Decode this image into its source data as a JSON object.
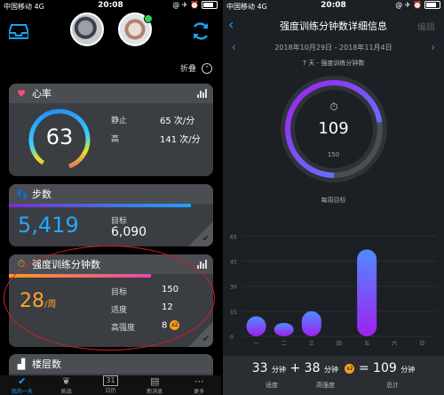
{
  "status_left": {
    "carrier": "中国移动",
    "network": "4G",
    "time": "20:08"
  },
  "status_right": {
    "carrier": "中国移动",
    "network": "4G",
    "time": "20:08"
  },
  "left": {
    "collapse_label": "折叠",
    "heart": {
      "title": "心率",
      "value": "63",
      "rest_label": "静止",
      "rest_value": "65 次/分",
      "high_label": "高",
      "high_value": "141 次/分"
    },
    "steps": {
      "title": "步数",
      "value": "5,419",
      "goal_label": "目标",
      "goal_value": "6,090"
    },
    "intensity": {
      "title": "强度训练分钟数",
      "value": "28",
      "unit": "/周",
      "goal_label": "目标",
      "goal_value": "150",
      "moderate_label": "适度",
      "moderate_value": "12",
      "vigorous_label": "高强度",
      "vigorous_value": "8",
      "badge": "x2"
    },
    "floors": {
      "title": "楼层数"
    },
    "tabs": [
      {
        "label": "我的一天",
        "icon": "check-icon"
      },
      {
        "label": "挑战",
        "icon": "laurel-icon"
      },
      {
        "label": "日历",
        "icon": "calendar-icon",
        "day": "31"
      },
      {
        "label": "新消息",
        "icon": "news-icon"
      },
      {
        "label": "更多",
        "icon": "more-icon"
      }
    ]
  },
  "right": {
    "title": "强度训练分钟数详细信息",
    "edit_label": "编辑",
    "date_range": "2018年10月29日 - 2018年11月4日",
    "subtitle": "7 天 - 强度训练分钟数",
    "gauge_value": "109",
    "gauge_goal": "150",
    "goal_caption": "每周目标",
    "summary": {
      "moderate": "33",
      "vigorous": "38",
      "total": "109",
      "unit": "分钟",
      "plus": "+",
      "equals": "=",
      "badge": "x2",
      "moderate_label": "适度",
      "vigorous_label": "高强度",
      "total_label": "总计"
    }
  },
  "chart_data": {
    "type": "bar",
    "categories": [
      "一",
      "二",
      "三",
      "四",
      "五",
      "六",
      "日"
    ],
    "values": [
      12,
      8,
      15,
      0,
      52,
      0,
      0
    ],
    "ylim": [
      0,
      65
    ],
    "yticks": [
      0,
      15,
      30,
      45,
      60
    ],
    "ytick_labels": [
      "0",
      "15",
      "30",
      "45",
      "65"
    ],
    "colors": {
      "top": "#4f8bff",
      "bottom": "#a020f0"
    }
  }
}
